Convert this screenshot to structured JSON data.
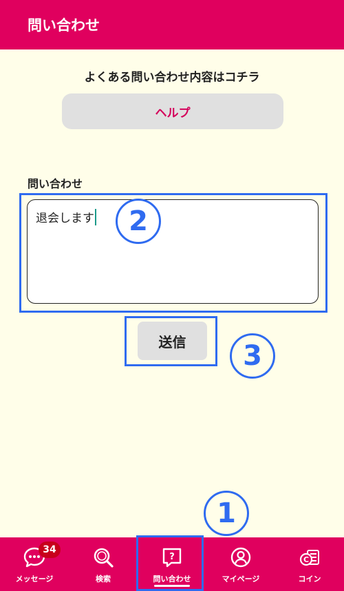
{
  "header": {
    "title": "問い合わせ"
  },
  "faq": {
    "text": "よくある問い合わせ内容はコチラ",
    "help_label": "ヘルプ"
  },
  "form": {
    "label": "問い合わせ",
    "value": "退会します",
    "send_label": "送信"
  },
  "annotations": {
    "one": "1",
    "two": "2",
    "three": "3"
  },
  "nav": {
    "items": [
      {
        "label": "メッセージ",
        "icon": "chat-bubble-icon",
        "badge": "34"
      },
      {
        "label": "検索",
        "icon": "search-icon"
      },
      {
        "label": "問い合わせ",
        "icon": "inquiry-icon",
        "active": true
      },
      {
        "label": "マイページ",
        "icon": "user-icon"
      },
      {
        "label": "コイン",
        "icon": "coin-icon"
      }
    ]
  },
  "colors": {
    "brand": "#e0005e",
    "highlight": "#2f6bf0",
    "background": "#fffee9"
  }
}
